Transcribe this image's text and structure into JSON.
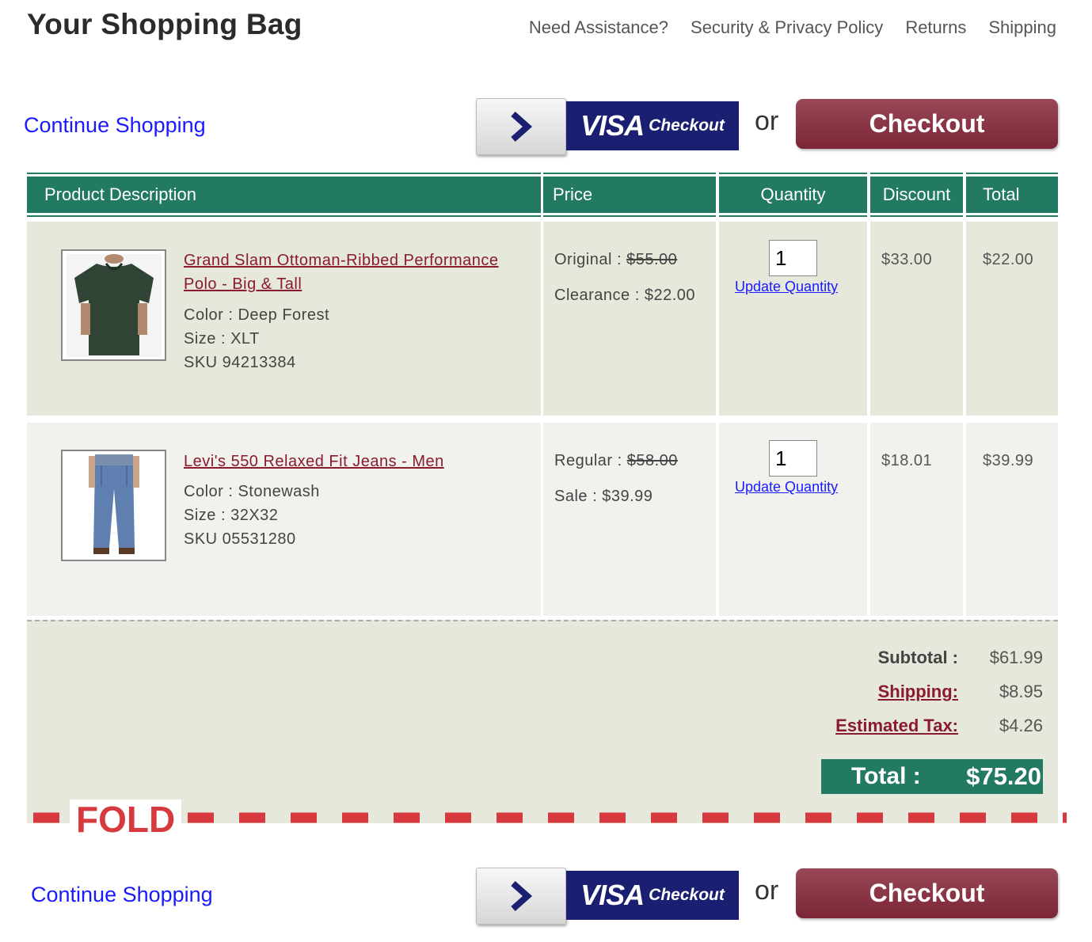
{
  "header": {
    "title": "Your Shopping Bag",
    "links": [
      "Need Assistance?",
      "Security & Privacy Policy",
      "Returns",
      "Shipping"
    ]
  },
  "actions": {
    "continue_label": "Continue Shopping",
    "visa_word": "VISA",
    "visa_checkout": "Checkout",
    "or_text": "or",
    "checkout_label": "Checkout"
  },
  "table": {
    "headers": [
      "Product Description",
      "Price",
      "Quantity",
      "Discount",
      "Total"
    ],
    "items": [
      {
        "name_line1": "Grand Slam Ottoman-Ribbed Performance",
        "name_line2": "Polo - Big & Tall",
        "color": "Color : Deep Forest",
        "size": "Size : XLT",
        "sku": "SKU 94213384",
        "price_label_1": "Original :",
        "price_value_1": "$55.00",
        "price_label_2": "Clearance :",
        "price_value_2": "$22.00",
        "quantity": "1",
        "update_label": "Update Quantity",
        "discount": "$33.00",
        "total": "$22.00"
      },
      {
        "name_line1": "Levi's 550 Relaxed Fit Jeans - Men",
        "color": "Color : Stonewash",
        "size": "Size : 32X32",
        "sku": "SKU 05531280",
        "price_label_1": "Regular :",
        "price_value_1": "$58.00",
        "price_label_2": "Sale :",
        "price_value_2": "$39.99",
        "quantity": "1",
        "update_label": "Update Quantity",
        "discount": "$18.01",
        "total": "$39.99"
      }
    ]
  },
  "summary": {
    "subtotal_label": "Subtotal :",
    "subtotal_value": "$61.99",
    "shipping_label": "Shipping:",
    "shipping_value": "$8.95",
    "tax_label": "Estimated Tax:",
    "tax_value": "$4.26",
    "total_label": "Total :",
    "total_value": "$75.20"
  },
  "fold_label": "FOLD",
  "colors": {
    "header_green": "#237a62",
    "checkout_maroon": "#8b3444",
    "visa_blue": "#1a1f71",
    "link_blue": "#1a1aff",
    "product_link": "#8b1a2d",
    "fold_red": "#d63a3e"
  }
}
